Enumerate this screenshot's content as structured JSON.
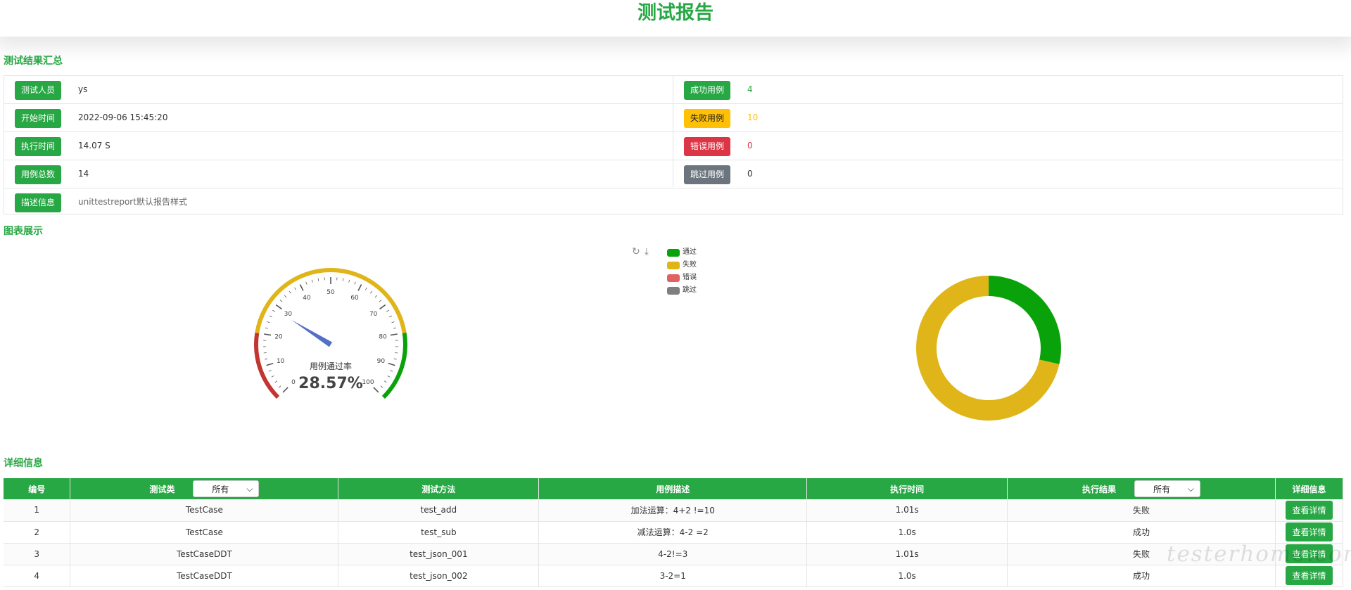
{
  "header": {
    "title": "测试报告"
  },
  "summary": {
    "title": "测试结果汇总",
    "left": [
      {
        "label": "测试人员",
        "value": "ys"
      },
      {
        "label": "开始时间",
        "value": "2022-09-06 15:45:20"
      },
      {
        "label": "执行时间",
        "value": "14.07 S"
      },
      {
        "label": "用例总数",
        "value": "14"
      }
    ],
    "right": [
      {
        "label": "成功用例",
        "value": "4",
        "color": "#28a745"
      },
      {
        "label": "失败用例",
        "value": "10",
        "color": "#ffc107"
      },
      {
        "label": "错误用例",
        "value": "0",
        "color": "#dc3545"
      },
      {
        "label": "跳过用例",
        "value": "0",
        "color": "#6c757d"
      }
    ],
    "desc": {
      "label": "描述信息",
      "value": "unittestreport默认报告样式"
    }
  },
  "charts": {
    "title": "图表展示",
    "gauge": {
      "label": "用例通过率",
      "value_text": "28.57%",
      "value": 28.57,
      "ticks": [
        "0",
        "10",
        "20",
        "30",
        "40",
        "50",
        "60",
        "70",
        "80",
        "90",
        "100"
      ]
    },
    "legend": [
      {
        "name": "通过",
        "color": "#0aa20a"
      },
      {
        "name": "失败",
        "color": "#e0b519"
      },
      {
        "name": "错误",
        "color": "#e06262"
      },
      {
        "name": "跳过",
        "color": "#7f7f7f"
      }
    ],
    "donut": {
      "pass": 4,
      "fail": 10,
      "error": 0,
      "skip": 0
    }
  },
  "detail": {
    "title": "详细信息",
    "headers": [
      "编号",
      "测试类",
      "测试方法",
      "用例描述",
      "执行时间",
      "执行结果",
      "详细信息"
    ],
    "filter_label": "所有",
    "button_label": "查看详情",
    "rows": [
      {
        "id": "1",
        "cls": "TestCase",
        "method": "test_add",
        "desc": "加法运算：4+2 !=10",
        "time": "1.01s",
        "result": "失败"
      },
      {
        "id": "2",
        "cls": "TestCase",
        "method": "test_sub",
        "desc": "减法运算：4-2 =2",
        "time": "1.0s",
        "result": "成功"
      },
      {
        "id": "3",
        "cls": "TestCaseDDT",
        "method": "test_json_001",
        "desc": "4-2!=3",
        "time": "1.01s",
        "result": "失败"
      },
      {
        "id": "4",
        "cls": "TestCaseDDT",
        "method": "test_json_002",
        "desc": "3-2=1",
        "time": "1.0s",
        "result": "成功"
      }
    ]
  },
  "watermark": "testerhome.com"
}
